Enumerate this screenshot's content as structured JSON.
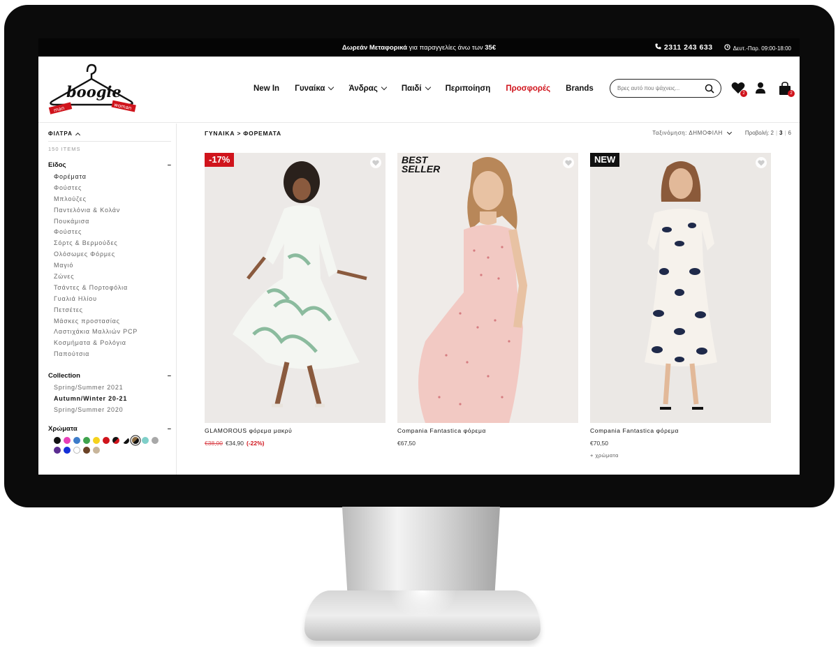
{
  "topbar": {
    "promo_bold": "Δωρεάν Μεταφορικά",
    "promo_text": " για παραγγελίες άνω των ",
    "promo_amount": "35€",
    "phone": "2311 243 633",
    "hours": "Δευτ.-Παρ. 09:00-18:00"
  },
  "logo": {
    "text": "boogie",
    "left_word": "man",
    "right_word": "woman"
  },
  "nav": {
    "items": [
      {
        "label": "New In"
      },
      {
        "label": "Γυναίκα"
      },
      {
        "label": "Άνδρας"
      },
      {
        "label": "Παιδί"
      },
      {
        "label": "Περιποίηση"
      },
      {
        "label": "Προσφορές"
      },
      {
        "label": "Brands"
      }
    ]
  },
  "search": {
    "placeholder": "Βρες αυτό που ψάχνεις..."
  },
  "header_icons": {
    "wishlist_count": "2",
    "cart_count": "2"
  },
  "sidebar": {
    "filters_title": "ΦΙΛΤΡΑ",
    "items_count": "150 ITEMS",
    "type_title": "Είδος",
    "type_items": [
      "Φορέματα",
      "Φούστες",
      "Μπλούζες",
      "Παντελόνια & Κολάν",
      "Πουκάμισα",
      "Φούστες",
      "Σόρτς & Βερμούδες",
      "Ολόσωμες Φόρμες",
      "Μαγιό",
      "Ζώνες",
      "Τσάντες & Πορτοφόλια",
      "Γυαλιά Ηλίου",
      "Πετσέτες",
      "Μάσκες προστασίας",
      "Λαστιχάκια Μαλλιών PCP",
      "Κοσμήματα & Ρολόγια",
      "Παπούτσια"
    ],
    "collection_title": "Collection",
    "collection_items": [
      "Spring/Summer 2021",
      "Autumn/Winter 20-21",
      "Spring/Summer 2020"
    ],
    "colors_title": "Χρώματα",
    "minus": "–",
    "colors": [
      "#111111",
      "#e83fb8",
      "#3d7cc9",
      "#3fa34d",
      "#f5d21c",
      "#d0141c",
      "split-red-black",
      "split-black-white",
      "selected-black",
      "#7fcfc9",
      "#a8a8a8",
      "#5b2d91",
      "#1530d8",
      "#ffffff",
      "#6b4226",
      "#c8b59a"
    ]
  },
  "main": {
    "breadcrumb": "ΓΥΝΑΙΚΑ > ΦΟΡΕΜΑΤΑ",
    "sort_label": "Ταξινόμηση: ΔΗΜΟΦΙΛΗ",
    "views_label": "Προβολή:",
    "view_options": [
      "2",
      "3",
      "6"
    ],
    "view_sep": "|",
    "products": [
      {
        "tag": "-17%",
        "name": "GLAMOROUS φόρεμα μακρύ",
        "old_price": "€38,00",
        "price": "€34,90",
        "discount": "(-22%)"
      },
      {
        "tag_line1": "BEST",
        "tag_line2": "SELLER",
        "name": "Compania Fantastica φόρεμα",
        "price": "€67,50"
      },
      {
        "tag": "NEW",
        "name": "Compania Fantastica φόρεμα",
        "price": "€70,50",
        "more": "+ χρώματα"
      }
    ]
  }
}
